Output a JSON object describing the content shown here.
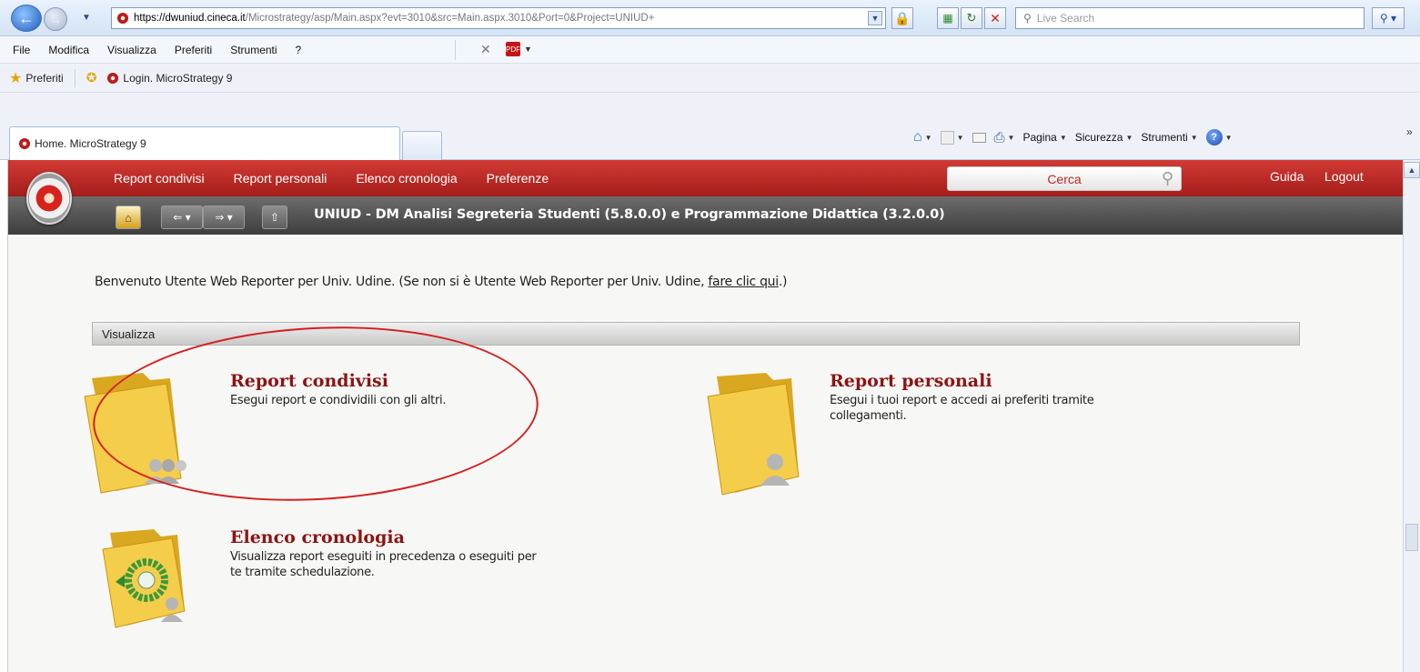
{
  "browser": {
    "url_prefix": "https://dwuniud.",
    "url_domain": "cineca.it",
    "url_rest": "/Microstrategy/asp/Main.aspx?evt=3010&src=Main.aspx.3010&Port=0&Project=UNIUD+",
    "search_placeholder": "Live Search",
    "menu": [
      "File",
      "Modifica",
      "Visualizza",
      "Preferiti",
      "Strumenti",
      "?"
    ],
    "favorites_label": "Preferiti",
    "favorite_link": "Login. MicroStrategy 9",
    "active_tab": "Home. MicroStrategy 9",
    "command_bar": {
      "pagina": "Pagina",
      "sicurezza": "Sicurezza",
      "strumenti": "Strumenti"
    },
    "icons": [
      "back-icon",
      "forward-icon",
      "lock-icon",
      "refresh-icon",
      "stop-icon",
      "search-icon",
      "home-icon",
      "rss-icon",
      "mail-icon",
      "print-icon",
      "help-icon"
    ]
  },
  "app": {
    "nav": [
      "Report condivisi",
      "Report personali",
      "Elenco cronologia",
      "Preferenze"
    ],
    "search_label": "Cerca",
    "help_label": "Guida",
    "logout_label": "Logout",
    "project_title": "UNIUD - DM Analisi Segreteria Studenti (5.8.0.0) e Programmazione Didattica (3.2.0.0)",
    "welcome_text": "Benvenuto Utente Web Reporter per Univ. Udine. (Se non si è Utente Web Reporter per Univ. Udine, ",
    "welcome_link": "fare clic qui",
    "welcome_suffix": ".)",
    "section_title": "Visualizza",
    "items": [
      {
        "title": "Report condivisi",
        "desc": "Esegui report e condividili con gli altri."
      },
      {
        "title": "Report personali",
        "desc_line1": "Esegui i tuoi report e accedi ai preferiti tramite",
        "desc_line2": "collegamenti."
      },
      {
        "title": "Elenco cronologia",
        "desc_line1": "Visualizza report eseguiti in precedenza o eseguiti per",
        "desc_line2": "te tramite schedulazione."
      }
    ],
    "colors": {
      "header_red": "#b82622",
      "title_red": "#8c1414",
      "annotation": "#d42020"
    }
  }
}
